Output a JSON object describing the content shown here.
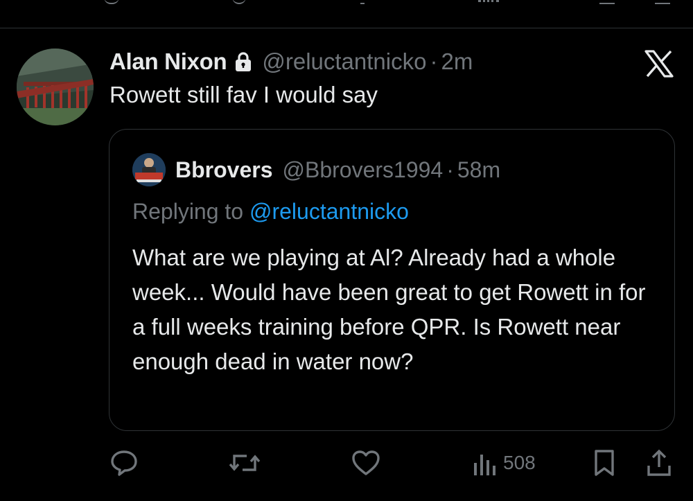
{
  "tweet": {
    "display_name": "Alan Nixon",
    "handle": "@reluctantnicko",
    "separator": "·",
    "time": "2m",
    "text": "Rowett still fav I would say"
  },
  "quoted": {
    "display_name": "Bbrovers",
    "handle": "@Bbrovers1994",
    "separator": "·",
    "time": "58m",
    "replying_to_prefix": "Replying to ",
    "replying_to_handle": "@reluctantnicko",
    "text": "What are we playing at Al? Already had a whole week... Would have been great to get Rowett in for a full weeks training before QPR. Is Rowett near enough dead in water now?"
  },
  "actions": {
    "reply_icon": "reply-icon",
    "retweet_icon": "retweet-icon",
    "like_icon": "like-icon",
    "views_icon": "views-icon",
    "views_count": "508",
    "bookmark_icon": "bookmark-icon",
    "share_icon": "share-icon"
  },
  "icons": {
    "lock": "lock-icon",
    "x_logo": "x-logo-icon"
  },
  "colors": {
    "background": "#000000",
    "text_primary": "#e7e9ea",
    "text_secondary": "#71767b",
    "link": "#1d9bf0",
    "border": "#2f3336"
  }
}
